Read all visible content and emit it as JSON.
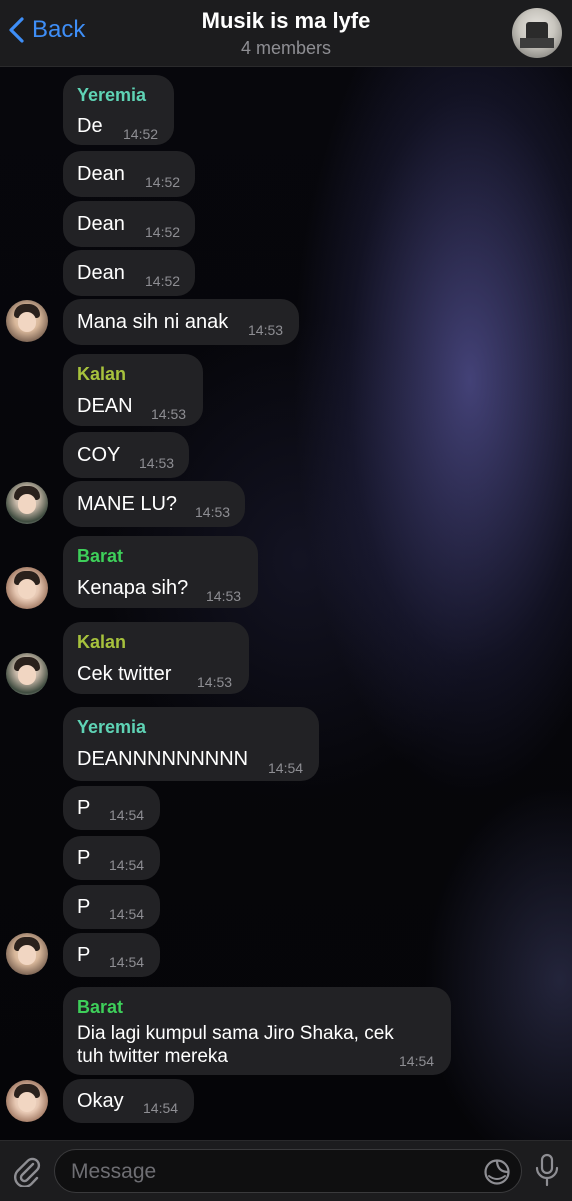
{
  "header": {
    "back_label": "Back",
    "title": "Musik is ma lyfe",
    "subtitle": "4 members"
  },
  "colors": {
    "accent": "#3e8ef7",
    "bubble": "#222225",
    "yeremia": "#5fd3b5",
    "kalan": "#a7c23d",
    "barat": "#3ecf5a"
  },
  "messages": [
    {
      "sender": "Yeremia",
      "text": "De",
      "time": "14:52"
    },
    {
      "text": "Dean",
      "time": "14:52"
    },
    {
      "text": "Dean",
      "time": "14:52"
    },
    {
      "text": "Dean",
      "time": "14:52"
    },
    {
      "text": "Mana sih ni anak",
      "time": "14:53"
    },
    {
      "sender": "Kalan",
      "text": "DEAN",
      "time": "14:53"
    },
    {
      "text": "COY",
      "time": "14:53"
    },
    {
      "text": "MANE LU?",
      "time": "14:53"
    },
    {
      "sender": "Barat",
      "text": "Kenapa sih?",
      "time": "14:53"
    },
    {
      "sender": "Kalan",
      "text": "Cek twitter",
      "time": "14:53"
    },
    {
      "sender": "Yeremia",
      "text": "DEANNNNNNNNN",
      "time": "14:54"
    },
    {
      "text": "P",
      "time": "14:54"
    },
    {
      "text": "P",
      "time": "14:54"
    },
    {
      "text": "P",
      "time": "14:54"
    },
    {
      "text": "P",
      "time": "14:54"
    },
    {
      "sender": "Barat",
      "text_line1": "Dia lagi kumpul sama Jiro Shaka, cek",
      "text_line2": "tuh twitter mereka",
      "time": "14:54"
    },
    {
      "text": "Okay",
      "time": "14:54"
    }
  ],
  "input": {
    "placeholder": "Message"
  },
  "icons": {
    "back": "chevron-left-icon",
    "attach": "paperclip-icon",
    "sticker": "sticker-icon",
    "mic": "microphone-icon"
  }
}
